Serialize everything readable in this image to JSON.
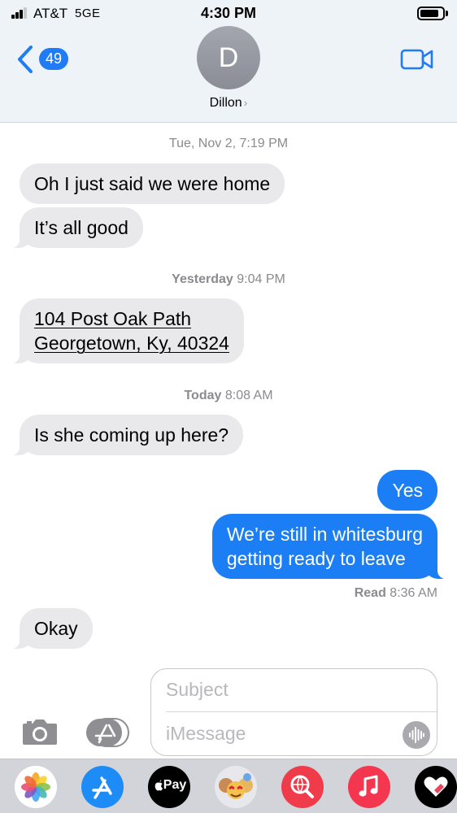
{
  "status_bar": {
    "carrier": "AT&T",
    "network": "5GE",
    "time": "4:30 PM",
    "signal_bars": 3,
    "battery_level": 0.85
  },
  "header": {
    "back_count": "49",
    "avatar_initial": "D",
    "contact_name": "Dillon",
    "contact_chevron": "›",
    "icons": [
      "back-chevron-icon",
      "video-call-icon"
    ]
  },
  "thread": {
    "timestamps": [
      {
        "day": "Tue, Nov 2,",
        "time": "7:19 PM"
      },
      {
        "day": "Yesterday",
        "time": "9:04 PM"
      },
      {
        "day": "Today",
        "time": "8:08 AM"
      }
    ],
    "messages": [
      {
        "direction": "incoming",
        "text": "Oh I just said we were home"
      },
      {
        "direction": "incoming",
        "text": "It’s all good"
      },
      {
        "direction": "incoming",
        "line1": "104 Post Oak Path",
        "line2": "Georgetown, Ky, 40324"
      },
      {
        "direction": "incoming",
        "text": "Is she coming up here?"
      },
      {
        "direction": "outgoing",
        "text": "Yes"
      },
      {
        "direction": "outgoing",
        "line1": "We’re still in whitesburg",
        "line2": "getting ready to leave"
      },
      {
        "direction": "incoming",
        "text": "Okay"
      }
    ],
    "read_receipt": {
      "label": "Read",
      "time": "8:36 AM"
    }
  },
  "compose": {
    "subject_placeholder": "Subject",
    "message_placeholder": "iMessage",
    "icons": [
      "camera-icon",
      "app-store-icon",
      "audio-waveform-icon"
    ]
  },
  "app_drawer": {
    "apple_pay_label": "Pay",
    "apps": [
      "photos-icon",
      "app-store-icon",
      "apple-pay-icon",
      "memoji-icon",
      "web-search-icon",
      "music-icon",
      "digital-touch-icon"
    ],
    "colors": {
      "photos_bg": "#ffffff",
      "app_store": "#1d8cf6",
      "apple_pay": "#000000",
      "search": "#f03b4b",
      "music": "#f5364f",
      "digital_touch": "#000000"
    }
  },
  "colors": {
    "accent": "#1c7ef5",
    "incoming_bubble": "#e9e9eb",
    "header_bg": "#eef3f8",
    "meta_text": "#8a8a8f"
  }
}
